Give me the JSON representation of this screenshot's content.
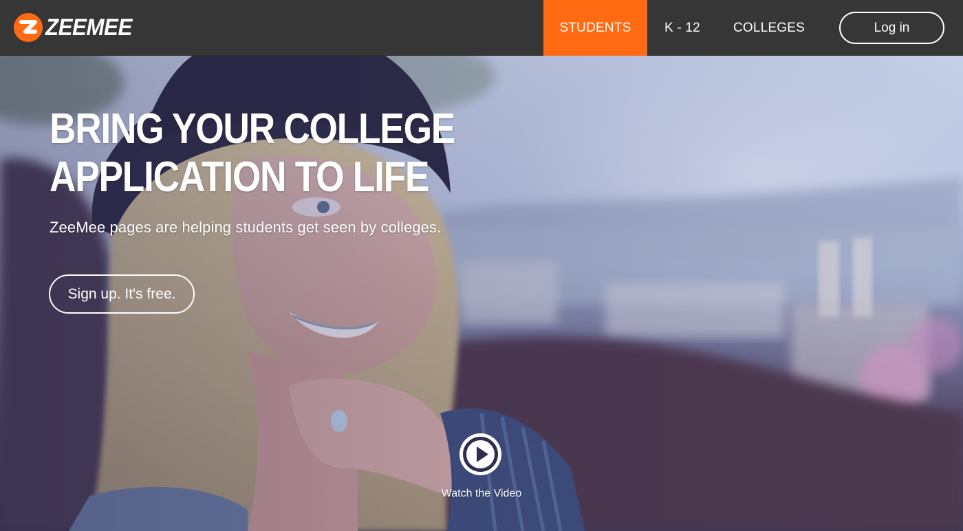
{
  "brand": {
    "logo_letter": "Z",
    "logo_text": "ZEEMEE",
    "accent_color": "#ff6a13",
    "nav_bg": "#363636"
  },
  "nav": {
    "items": [
      {
        "label": "STUDENTS",
        "active": true
      },
      {
        "label": "K - 12",
        "active": false
      },
      {
        "label": "COLLEGES",
        "active": false
      }
    ],
    "login_label": "Log in"
  },
  "hero": {
    "headline_line1": "BRING YOUR COLLEGE",
    "headline_line2": "APPLICATION TO LIFE",
    "subtitle": "ZeeMee pages are helping students get seen by colleges.",
    "signup_label": "Sign up. It's free.",
    "video_label": "Watch the Video",
    "play_icon": "play-icon"
  }
}
